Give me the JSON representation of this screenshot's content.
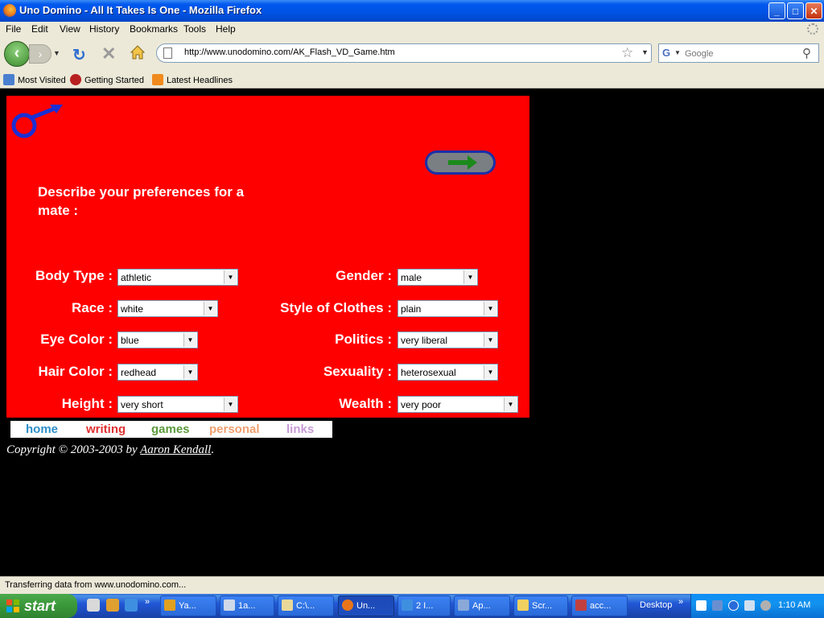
{
  "window": {
    "title": "Uno Domino - All It Takes Is One - Mozilla Firefox",
    "controls": {
      "minimize": "_",
      "maximize": "□",
      "close": "✕"
    }
  },
  "menu": [
    "File",
    "Edit",
    "View",
    "History",
    "Bookmarks",
    "Tools",
    "Help"
  ],
  "nav": {
    "url": "http://www.unodomino.com/AK_Flash_VD_Game.htm",
    "search_placeholder": "Google",
    "search_engine_letter": "G"
  },
  "bookmarks": [
    "Most Visited",
    "Getting Started",
    "Latest Headlines"
  ],
  "page": {
    "heading": "Describe your preferences for a mate :",
    "fields_left": [
      {
        "label": "Body Type :",
        "value": "athletic"
      },
      {
        "label": "Race :",
        "value": "white"
      },
      {
        "label": "Eye Color :",
        "value": "blue"
      },
      {
        "label": "Hair Color :",
        "value": "redhead"
      },
      {
        "label": "Height :",
        "value": "very short"
      }
    ],
    "fields_right": [
      {
        "label": "Gender :",
        "value": "male"
      },
      {
        "label": "Style of Clothes :",
        "value": "plain"
      },
      {
        "label": "Politics :",
        "value": "very liberal"
      },
      {
        "label": "Sexuality :",
        "value": "heterosexual"
      },
      {
        "label": "Wealth :",
        "value": "very poor"
      }
    ],
    "site_nav": [
      {
        "label": "home",
        "color": "#2c8fc9"
      },
      {
        "label": "writing",
        "color": "#e03030"
      },
      {
        "label": "games",
        "color": "#5a9a3a"
      },
      {
        "label": "personal",
        "color": "#f0a070"
      },
      {
        "label": "links",
        "color": "#c69ad6"
      }
    ],
    "copyright_prefix": "Copyright © 2003-2003 by ",
    "copyright_author": "Aaron Kendall",
    "copyright_suffix": "."
  },
  "status": "Transferring data from www.unodomino.com...",
  "taskbar": {
    "start": "start",
    "tasks": [
      "Ya...",
      "1a...",
      "C:\\...",
      "Un...",
      "2 I...",
      "Ap...",
      "Scr...",
      "acc..."
    ],
    "desktop": "Desktop",
    "clock": "1:10 AM"
  },
  "colors": {
    "flash_bg": "#ff0000",
    "page_bg": "#000000",
    "male_symbol": "#1a2fd4",
    "arrow": "#1b8a1b"
  }
}
